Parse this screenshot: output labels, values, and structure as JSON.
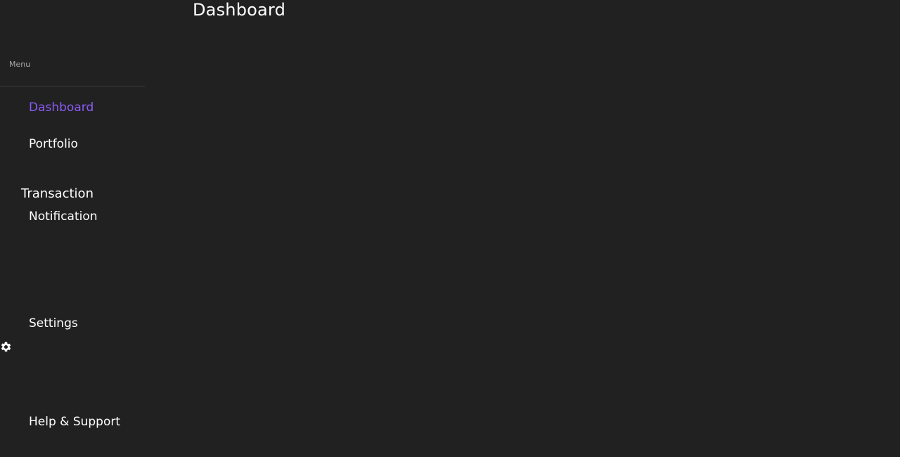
{
  "header": {
    "title": "Dashboard"
  },
  "sidebar": {
    "menu_label": "Menu",
    "active_color": "#8b5cf6",
    "items": [
      {
        "label": "Dashboard",
        "active": true
      },
      {
        "label": "Portfolio",
        "active": false
      },
      {
        "label": "Transaction",
        "active": false
      },
      {
        "label": "Notification",
        "active": false
      },
      {
        "label": "Settings",
        "active": false
      },
      {
        "label": "Help & Support",
        "active": false
      }
    ],
    "settings_icon": "gear-icon"
  }
}
